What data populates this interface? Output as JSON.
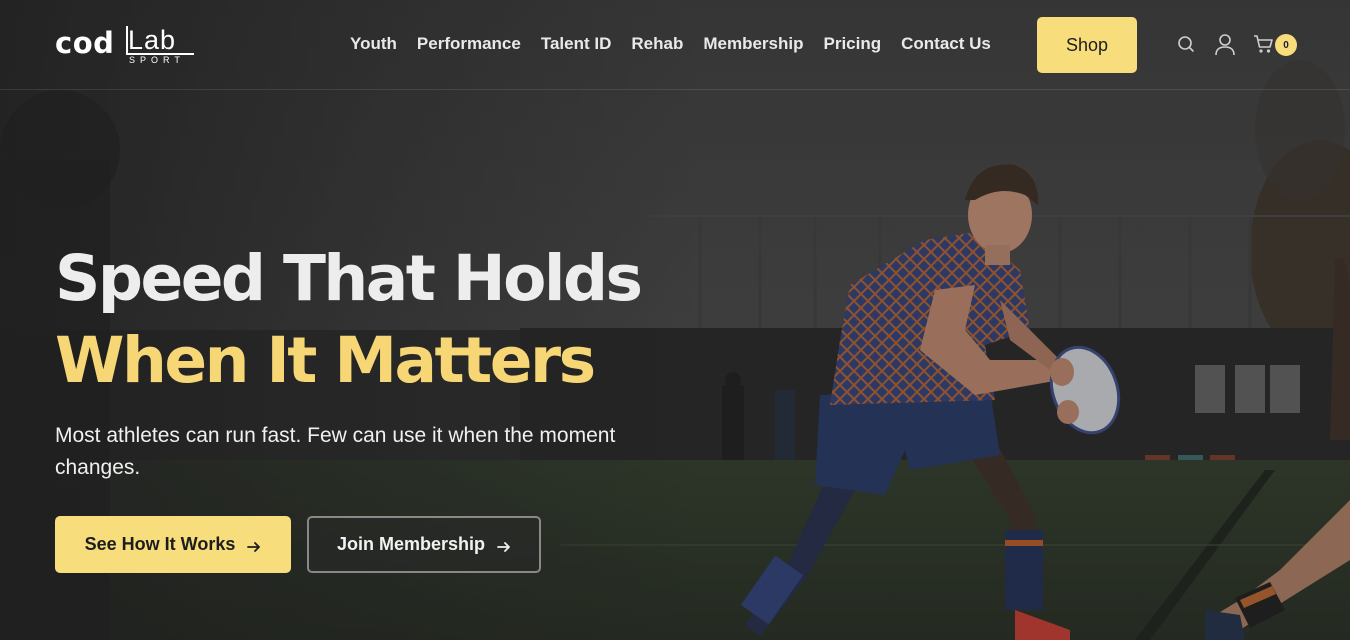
{
  "brand": {
    "logo_main": "cod",
    "logo_secondary": "Lab",
    "logo_sub": "SPORT"
  },
  "nav": {
    "items": [
      {
        "label": "Youth"
      },
      {
        "label": "Performance"
      },
      {
        "label": "Talent ID"
      },
      {
        "label": "Rehab"
      },
      {
        "label": "Membership"
      },
      {
        "label": "Pricing"
      },
      {
        "label": "Contact Us"
      }
    ],
    "shop_label": "Shop"
  },
  "header_icons": {
    "search": "search-icon",
    "account": "user-icon",
    "cart": "cart-icon",
    "cart_count": "0"
  },
  "hero": {
    "headline_line1": "Speed That Holds",
    "headline_line2": "When It Matters",
    "subtitle": "Most athletes can run fast. Few can use it when the moment changes.",
    "primary_button": "See How It Works",
    "secondary_button": "Join Membership",
    "button_icon": "arrow-right-icon"
  },
  "colors": {
    "accent": "#f8dd7c",
    "headline_accent": "#f6d675",
    "overlay": "#2b2b2b"
  }
}
